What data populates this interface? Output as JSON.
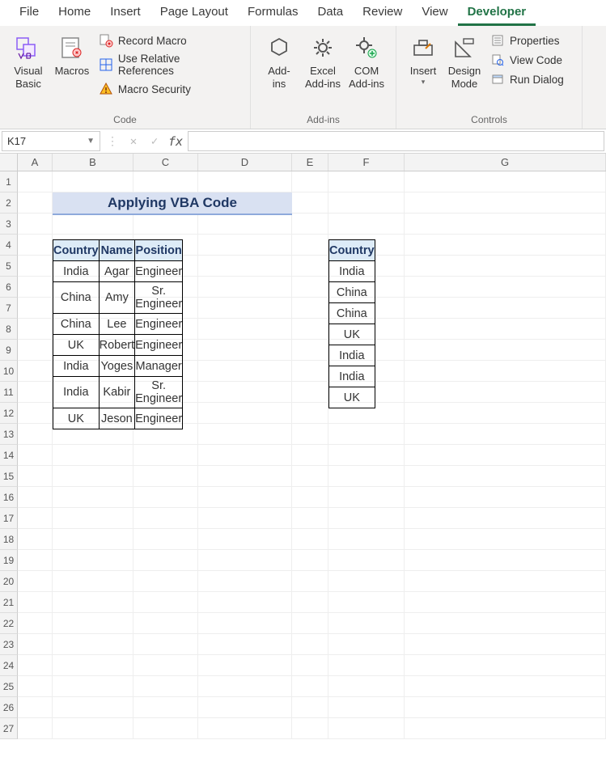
{
  "tabs": [
    "File",
    "Home",
    "Insert",
    "Page Layout",
    "Formulas",
    "Data",
    "Review",
    "View",
    "Developer"
  ],
  "active_tab": "Developer",
  "ribbon": {
    "code": {
      "title": "Code",
      "vb": "Visual\nBasic",
      "macros": "Macros",
      "record": "Record Macro",
      "relative": "Use Relative References",
      "security": "Macro Security"
    },
    "addins": {
      "title": "Add-ins",
      "addins": "Add-\nins",
      "excel": "Excel\nAdd-ins",
      "com": "COM\nAdd-ins"
    },
    "controls": {
      "title": "Controls",
      "insert": "Insert",
      "design": "Design\nMode",
      "props": "Properties",
      "viewcode": "View Code",
      "rundlg": "Run Dialog"
    }
  },
  "namebox": "K17",
  "formula": "",
  "columns": [
    "A",
    "B",
    "C",
    "D",
    "E",
    "F",
    "G"
  ],
  "title_text": "Applying VBA Code",
  "table1": {
    "headers": [
      "Country",
      "Name",
      "Position"
    ],
    "rows": [
      [
        "India",
        "Agar",
        "Engineer"
      ],
      [
        "China",
        "Amy",
        "Sr. Engineer"
      ],
      [
        "China",
        "Lee",
        "Engineer"
      ],
      [
        "UK",
        "Robert",
        "Engineer"
      ],
      [
        "India",
        "Yoges",
        "Manager"
      ],
      [
        "India",
        "Kabir",
        "Sr. Engineer"
      ],
      [
        "UK",
        "Jeson",
        "Engineer"
      ]
    ]
  },
  "table2": {
    "header": "Country",
    "rows": [
      "India",
      "China",
      "China",
      "UK",
      "India",
      "India",
      "UK"
    ]
  },
  "row_count": 27
}
